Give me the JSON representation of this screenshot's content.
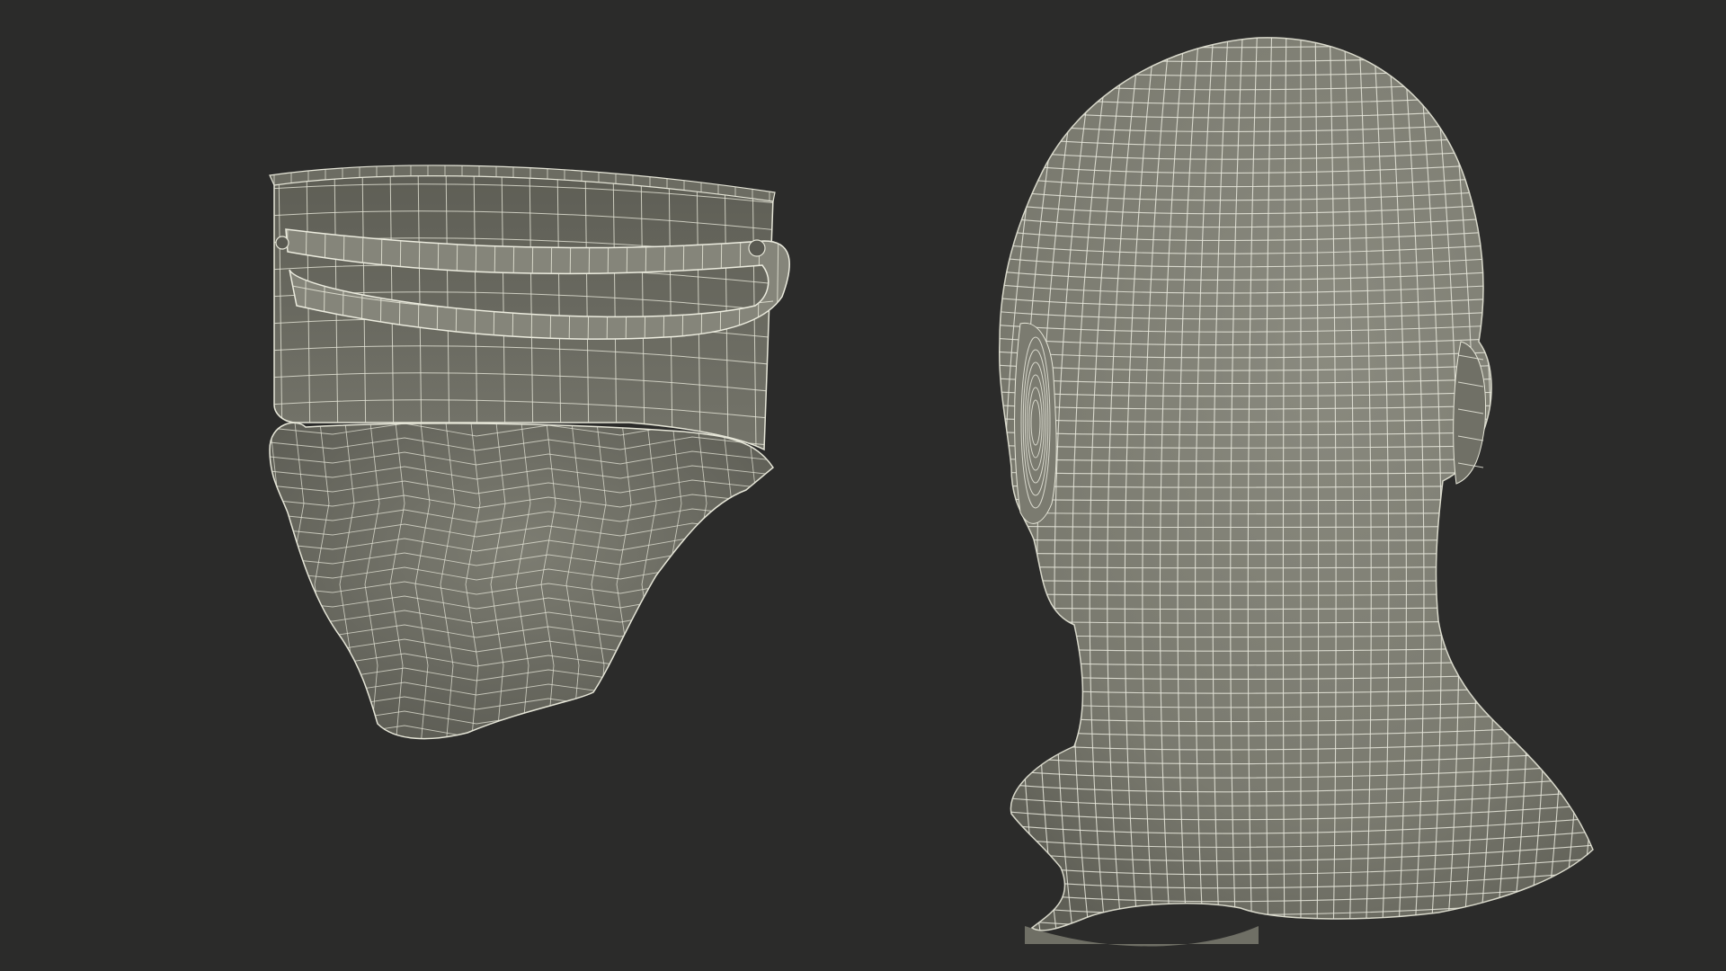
{
  "scene": {
    "background": "#2b2b2a",
    "models": [
      {
        "name": "face-shield-mask-wireframe",
        "surface_color": "#7e7e72",
        "wire_color": "#e6e6d8"
      },
      {
        "name": "head-bust-wireframe",
        "surface_color": "#808075",
        "wire_color": "#e8e8dc"
      }
    ]
  }
}
